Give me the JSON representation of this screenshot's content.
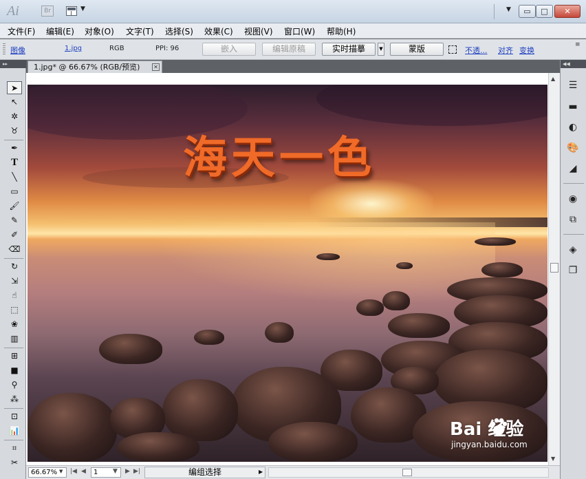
{
  "window": {
    "app_logo": "Ai",
    "bridge_logo": "Br",
    "controls": {
      "minimize": "▭",
      "maximize": "□",
      "close": "✕"
    }
  },
  "menu": [
    "文件(F)",
    "编辑(E)",
    "对象(O)",
    "文字(T)",
    "选择(S)",
    "效果(C)",
    "视图(V)",
    "窗口(W)",
    "帮助(H)"
  ],
  "control_bar": {
    "type_link": "图像",
    "file_name": "1.jpg",
    "color_mode": "RGB",
    "ppi": "PPI: 96",
    "embed_button": "嵌入",
    "edit_original_button": "编辑原稿",
    "live_trace_button": "实时描摹",
    "mask_button": "蒙版",
    "opacity_link": "不透...",
    "align_link": "对齐",
    "transform_link": "变换"
  },
  "document": {
    "tab_title": "1.jpg* @ 66.67% (RGB/预览)",
    "artwork_title": "海天一色",
    "watermark_main": "Bai 经验",
    "watermark_sub": "jingyan.baidu.com"
  },
  "status": {
    "zoom": "66.67%",
    "page": "1",
    "mode_text": "编组选择"
  },
  "icons": {
    "tools": [
      "selection-icon",
      "direct-selection-icon",
      "magic-wand-icon",
      "lasso-icon",
      "pen-icon",
      "type-icon",
      "line-icon",
      "rectangle-icon",
      "paintbrush-icon",
      "pencil-icon",
      "blob-brush-icon",
      "eraser-icon",
      "rotate-icon",
      "scale-icon",
      "warp-icon",
      "free-transform-icon",
      "symbol-sprayer-icon",
      "column-graph-icon",
      "mesh-icon",
      "gradient-icon",
      "eyedropper-icon",
      "blend-icon",
      "live-paint-icon",
      "bar-chart-icon",
      "artboard-icon",
      "slice-icon"
    ],
    "panels": [
      "stroke-panel-icon",
      "gradient-panel-icon",
      "transparency-panel-icon",
      "color-panel-icon",
      "appearance-panel-icon",
      "graphic-styles-icon",
      "symbols-icon",
      "layers-icon",
      "artboards-icon"
    ]
  },
  "colors": {
    "title_text": "#f06a28",
    "link": "#1f3fbf",
    "panel_bg": "#d6d9dd"
  }
}
